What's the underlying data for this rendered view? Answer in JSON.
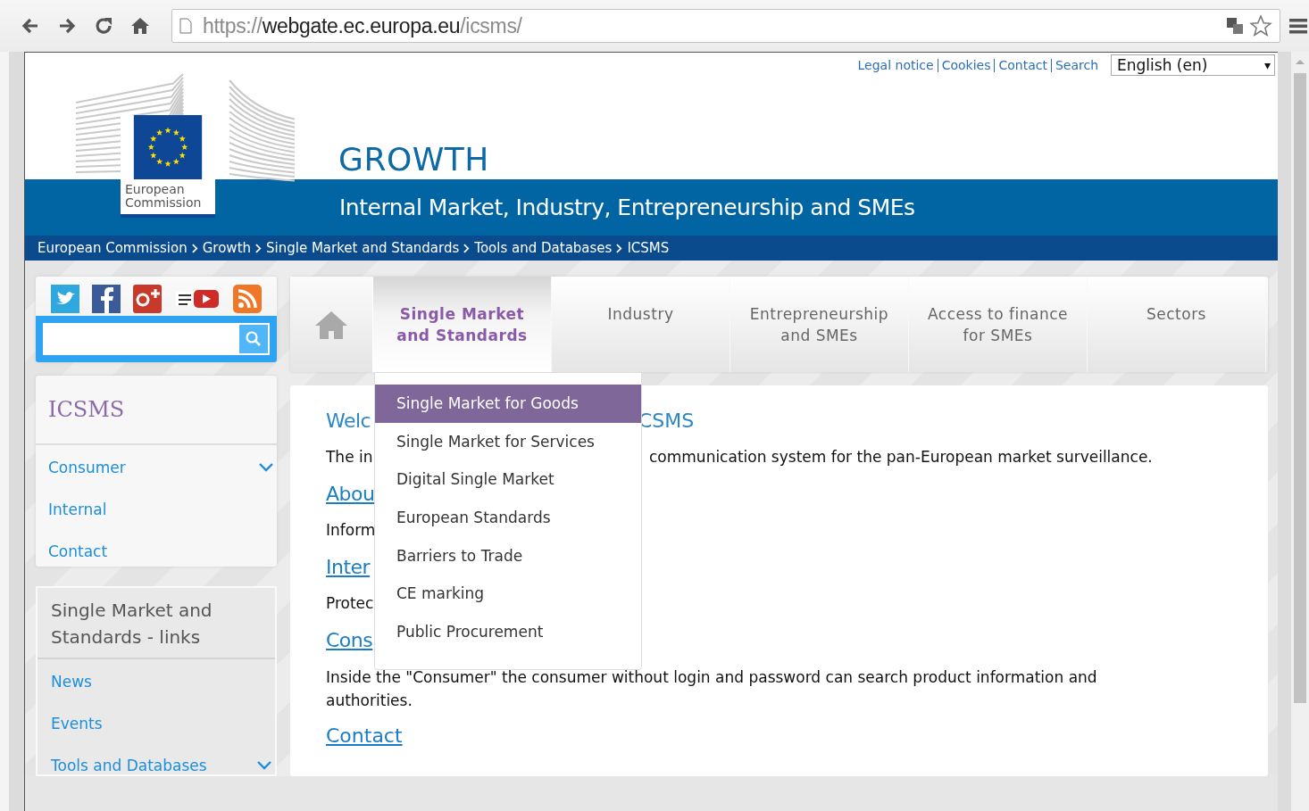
{
  "browser": {
    "url_scheme": "https://",
    "url_host": "webgate.ec.europa.eu",
    "url_path": "/icsms/"
  },
  "top_links": [
    "Legal notice",
    "Cookies",
    "Contact",
    "Search"
  ],
  "language_select": {
    "value": "English (en)",
    "arrow": "▾"
  },
  "logo": {
    "label": "European Commission"
  },
  "header": {
    "title": "GROWTH",
    "subtitle": "Internal Market, Industry, Entrepreneurship and SMEs"
  },
  "breadcrumb": [
    "European Commission",
    "Growth",
    "Single Market and Standards",
    "Tools and Databases",
    "ICSMS"
  ],
  "nav_tabs": [
    {
      "label": "Single Market and Standards",
      "selected": true
    },
    {
      "label": "Industry",
      "selected": false
    },
    {
      "label": "Entrepreneurship and SMEs",
      "selected": false
    },
    {
      "label": "Access to finance for SMEs",
      "selected": false
    },
    {
      "label": "Sectors",
      "selected": false
    }
  ],
  "dropdown": [
    {
      "label": "Single Market for Goods",
      "selected": true
    },
    {
      "label": "Single Market for Services",
      "selected": false
    },
    {
      "label": "Digital Single Market",
      "selected": false
    },
    {
      "label": "European Standards",
      "selected": false
    },
    {
      "label": "Barriers to Trade",
      "selected": false
    },
    {
      "label": "CE marking",
      "selected": false
    },
    {
      "label": "Public Procurement",
      "selected": false
    }
  ],
  "sidebar_menu": {
    "title": "ICSMS",
    "items": [
      {
        "label": "Consumer",
        "has_submenu": true
      },
      {
        "label": "Internal",
        "has_submenu": false
      },
      {
        "label": "Contact",
        "has_submenu": false
      }
    ]
  },
  "sidebar_links": {
    "title": "Single Market and Standards - links",
    "items": [
      {
        "label": "News",
        "has_submenu": false
      },
      {
        "label": "Events",
        "has_submenu": false
      },
      {
        "label": "Tools and Databases",
        "has_submenu": true
      }
    ]
  },
  "content_rows": [
    {
      "kind": "heading",
      "left": "Welc",
      "right": "CSMS"
    },
    {
      "kind": "text",
      "left": "The in",
      "right": "communication system for the pan-European market surveillance."
    },
    {
      "kind": "link",
      "left": "Abou"
    },
    {
      "kind": "text",
      "left": "Inform"
    },
    {
      "kind": "link",
      "left": "Inter"
    },
    {
      "kind": "text",
      "left": "Protec"
    },
    {
      "kind": "link",
      "left": "Cons"
    }
  ],
  "content_paragraph": "Inside the \"Consumer\" the consumer without login and password can search product information and authorities.",
  "content_link": "Contact"
}
